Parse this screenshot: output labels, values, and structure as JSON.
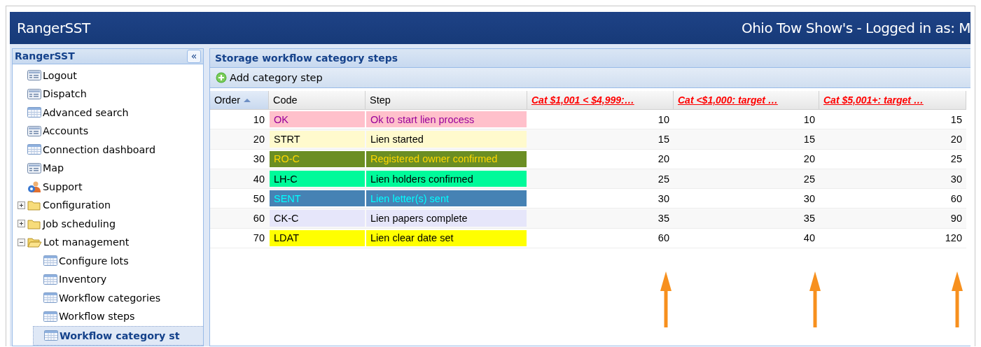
{
  "header": {
    "title": "RangerSST",
    "user_info": "Ohio Tow Show's - Logged in as: M"
  },
  "sidebar": {
    "title": "RangerSST",
    "collapse_button": "«",
    "items": [
      {
        "label": "Logout",
        "kind": "list",
        "selected": false
      },
      {
        "label": "Dispatch",
        "kind": "list",
        "selected": false
      },
      {
        "label": "Advanced search",
        "kind": "grid",
        "selected": false
      },
      {
        "label": "Accounts",
        "kind": "list",
        "selected": false
      },
      {
        "label": "Connection dashboard",
        "kind": "grid",
        "selected": false
      },
      {
        "label": "Map",
        "kind": "list",
        "selected": false
      },
      {
        "label": "Support",
        "kind": "support",
        "selected": false
      },
      {
        "label": "Configuration",
        "kind": "folder",
        "expanded": false,
        "selected": false
      },
      {
        "label": "Job scheduling",
        "kind": "folder",
        "expanded": false,
        "selected": false
      },
      {
        "label": "Lot management",
        "kind": "folder",
        "expanded": true,
        "selected": false,
        "children": [
          {
            "label": "Configure lots",
            "kind": "grid",
            "selected": false
          },
          {
            "label": "Inventory",
            "kind": "grid",
            "selected": false
          },
          {
            "label": "Workflow categories",
            "kind": "grid",
            "selected": false
          },
          {
            "label": "Workflow steps",
            "kind": "grid",
            "selected": false
          },
          {
            "label": "Workflow category st",
            "kind": "grid",
            "selected": true
          }
        ]
      }
    ]
  },
  "panel": {
    "title": "Storage workflow category steps",
    "toolbar": {
      "add_button": "Add category step"
    },
    "table": {
      "columns": [
        {
          "label": "Order",
          "kind": "sorted"
        },
        {
          "label": "Code",
          "kind": "plain"
        },
        {
          "label": "Step",
          "kind": "plain"
        },
        {
          "label": "Cat $1,001 < $4,999:…",
          "kind": "link"
        },
        {
          "label": "Cat <$1,000: target …",
          "kind": "link"
        },
        {
          "label": "Cat $5,001+: target …",
          "kind": "link"
        }
      ],
      "rows": [
        {
          "order": "10",
          "color": "#ffc0cb",
          "code": {
            "text": "OK",
            "color": "#990099"
          },
          "step": {
            "text": "Ok to start lien process",
            "color": "#990099"
          },
          "values": [
            "10",
            "10",
            "15"
          ]
        },
        {
          "order": "20",
          "color": "#fffacd",
          "code": {
            "text": "STRT",
            "color": "#000000"
          },
          "step": {
            "text": "Lien started",
            "color": "#000000"
          },
          "values": [
            "15",
            "15",
            "20"
          ]
        },
        {
          "order": "30",
          "color": "#6b8e23",
          "code": {
            "text": "RO-C",
            "color": "#ffd700"
          },
          "step": {
            "text": "Registered owner confirmed",
            "color": "#ffd700"
          },
          "values": [
            "20",
            "20",
            "25"
          ]
        },
        {
          "order": "40",
          "color": "#00fa9a",
          "code": {
            "text": "LH-C",
            "color": "#000000"
          },
          "step": {
            "text": "Lien holders confirmed",
            "color": "#000000"
          },
          "values": [
            "25",
            "25",
            "30"
          ]
        },
        {
          "order": "50",
          "color": "#4682b4",
          "code": {
            "text": "SENT",
            "color": "#00ffff"
          },
          "step": {
            "text": "Lien letter(s) sent",
            "color": "#00ffff"
          },
          "values": [
            "30",
            "30",
            "60"
          ]
        },
        {
          "order": "60",
          "color": "#e6e6fa",
          "code": {
            "text": "CK-C",
            "color": "#000000"
          },
          "step": {
            "text": "Lien papers complete",
            "color": "#000000"
          },
          "values": [
            "35",
            "35",
            "90"
          ]
        },
        {
          "order": "70",
          "color": "#ffff00",
          "code": {
            "text": "LDAT",
            "color": "#000000"
          },
          "step": {
            "text": "Lien clear date set",
            "color": "#000000"
          },
          "values": [
            "60",
            "40",
            "120"
          ]
        }
      ]
    }
  }
}
